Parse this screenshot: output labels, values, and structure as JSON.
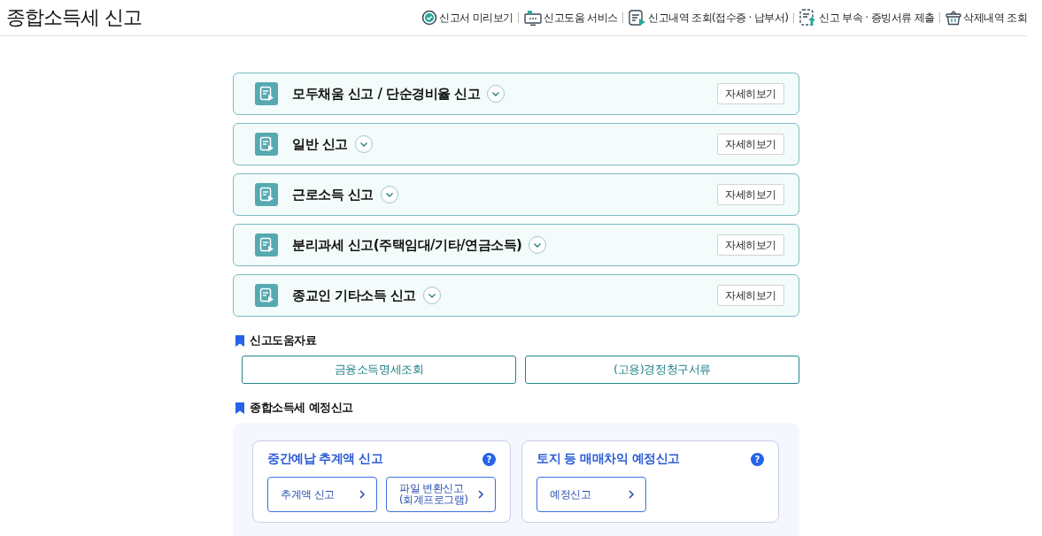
{
  "page_title": "종합소득세 신고",
  "top_links": [
    {
      "label": "신고서 미리보기",
      "kind": "preview"
    },
    {
      "label": "신고도움 서비스",
      "kind": "help"
    },
    {
      "label": "신고내역 조회(접수증 · 납부서)",
      "kind": "history"
    },
    {
      "label": "신고 부속 · 증빙서류 제출",
      "kind": "upload"
    },
    {
      "label": "삭제내역 조회",
      "kind": "deleted"
    }
  ],
  "report_panels": [
    {
      "title": "모두채움 신고 / 단순경비율 신고",
      "expanded": false,
      "button": "자세히보기"
    },
    {
      "title": "일반 신고",
      "expanded": false,
      "button": "자세히보기"
    },
    {
      "title": "근로소득 신고",
      "expanded": false,
      "button": "자세히보기"
    },
    {
      "title": "분리과세 신고(주택임대/기타/연금소득)",
      "expanded": false,
      "button": "자세히보기"
    },
    {
      "title": "종교인 기타소득 신고",
      "expanded": false,
      "button": "자세히보기"
    }
  ],
  "help_section": {
    "heading": "신고도움자료",
    "buttons": [
      "금융소득명세조회",
      "(고용)경정청구서류"
    ]
  },
  "estimate_section": {
    "heading": "종합소득세 예정신고",
    "cards": [
      {
        "title": "중간예납 추계액 신고",
        "help": "?",
        "buttons": [
          "추계액 신고",
          "파일 변환신고\n(회계프로그램)"
        ]
      },
      {
        "title": "토지 등 매매차익 예정신고",
        "help": "?",
        "buttons": [
          "예정신고"
        ]
      }
    ]
  }
}
